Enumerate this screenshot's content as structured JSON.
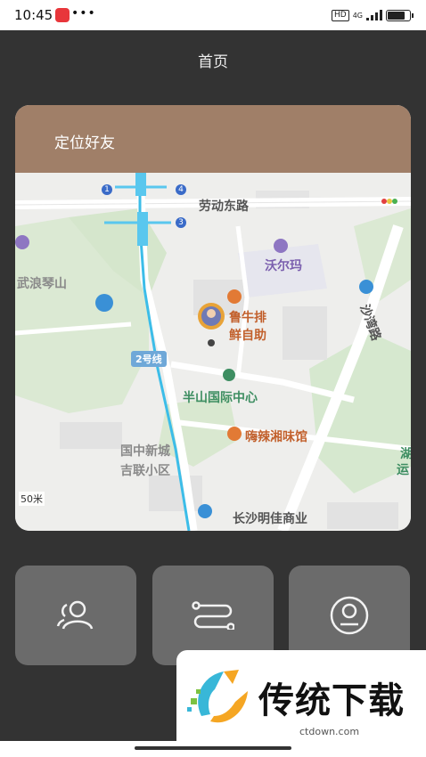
{
  "status_bar": {
    "time": "10:45",
    "dots": "•••",
    "hd": "HD",
    "network": "4G"
  },
  "header": {
    "title": "首页"
  },
  "card": {
    "title": "定位好友"
  },
  "map": {
    "labels": {
      "road_laodong": "劳动东路",
      "walmart": "沃尔玛",
      "wulangqinshan": "武浪琴山",
      "beef": "鲁牛排",
      "buffet": "鲜自助",
      "line2": "2号线",
      "shawan_road": "沙湾路",
      "banshan": "半山国际中心",
      "hunan_restaurant": "嗨辣湘味馆",
      "guozhong": "国中新城",
      "jilian": "吉联小区",
      "scale": "50米",
      "mingjia": "长沙明佳商业",
      "hu_yun": "湖",
      "yun": "运"
    },
    "metro_stations": [
      "1",
      "4",
      "3"
    ]
  },
  "actions": [
    {
      "icon": "friends-icon"
    },
    {
      "icon": "route-icon"
    },
    {
      "icon": "profile-icon"
    }
  ],
  "ad": {
    "text": "传统下载",
    "url": "ctdown.com"
  }
}
